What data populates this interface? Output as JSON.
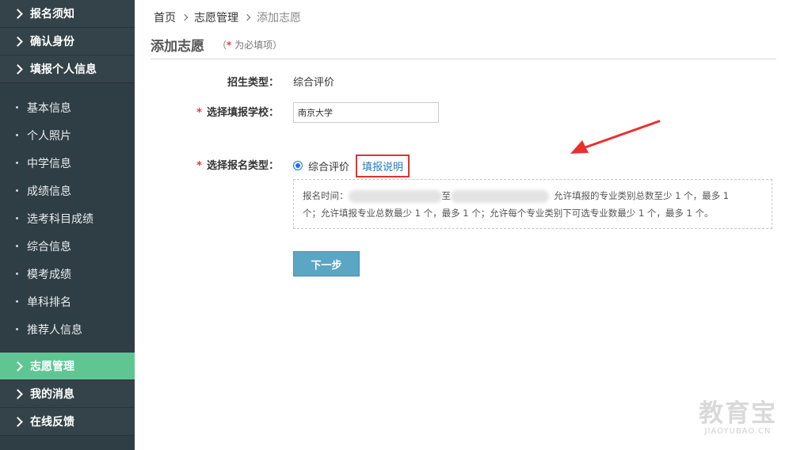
{
  "sidebar": {
    "top_sections": [
      "报名须知",
      "确认身份",
      "填报个人信息"
    ],
    "sub_items": [
      "基本信息",
      "个人照片",
      "中学信息",
      "成绩信息",
      "选考科目成绩",
      "综合信息",
      "模考成绩",
      "单科排名",
      "推荐人信息"
    ],
    "bottom_sections": [
      {
        "label": "志愿管理",
        "active": true
      },
      {
        "label": "我的消息",
        "active": false
      },
      {
        "label": "在线反馈",
        "active": false
      }
    ]
  },
  "breadcrumb": [
    "首页",
    "志愿管理",
    "添加志愿"
  ],
  "page": {
    "title": "添加志愿",
    "required_note_open": "（",
    "required_note_star": "*",
    "required_note_text": " 为必填项）"
  },
  "form": {
    "enroll_type_label": "招生类型：",
    "enroll_type_value": "综合评价",
    "school_label": "选择填报学校：",
    "school_value": "南京大学",
    "apply_type_label": "选择报名类型：",
    "apply_type_option": "综合评价",
    "help_link": "填报说明",
    "required_star": "*"
  },
  "notice": {
    "time_label": "报名时间：",
    "to_word": "至",
    "text_part1": "允许填报的专业类别总数至少 1 个，最多 1",
    "text_part2": "个；允许填报专业总数最少 1 个，最多 1 个；允许每个专业类别下可选专业数最少 1 个，最多 1 个。"
  },
  "buttons": {
    "next": "下一步"
  },
  "watermark": {
    "cn": "教育宝",
    "en": "JIAOYUBAO.CN"
  },
  "colors": {
    "sidebar_bg": "#2f3d44",
    "active_item": "#5fc693",
    "button": "#5ba6c4",
    "required": "#e4393c",
    "annotation": "#e8302f",
    "link": "#1f7cc4"
  }
}
